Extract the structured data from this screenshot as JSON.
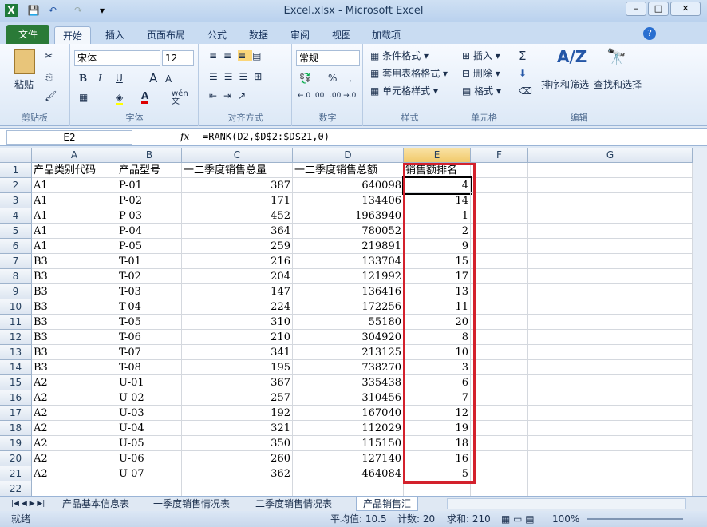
{
  "window": {
    "title": "Excel.xlsx - Microsoft Excel",
    "min": "–",
    "max": "□",
    "close": "✕"
  },
  "quick_access": {
    "excel_icon": "X",
    "save": "💾",
    "undo": "↶",
    "redo": "↷",
    "customize": "▾"
  },
  "tabs": [
    "文件",
    "开始",
    "插入",
    "页面布局",
    "公式",
    "数据",
    "审阅",
    "视图",
    "加载项"
  ],
  "ribbon": {
    "clipboard": {
      "label": "剪贴板",
      "paste": "粘贴"
    },
    "font": {
      "label": "字体",
      "name": "宋体",
      "size": "12",
      "bold": "B",
      "italic": "I",
      "underline": "U",
      "grow": "A",
      "shrink": "A",
      "color": "A",
      "wen": "wén 文"
    },
    "align": {
      "label": "对齐方式"
    },
    "number": {
      "label": "数字",
      "format": "常规",
      "percent": "%",
      "comma": ",",
      "inc": "←.0 .00",
      "dec": ".00 →.0"
    },
    "styles": {
      "label": "样式",
      "items": [
        "条件格式",
        "套用表格格式",
        "单元格样式"
      ]
    },
    "cells": {
      "label": "单元格",
      "items": [
        "插入",
        "删除",
        "格式"
      ]
    },
    "editing": {
      "label": "编辑",
      "sum": "Σ",
      "sort": "排序和筛选",
      "find": "查找和选择"
    }
  },
  "formula_bar": {
    "name_box": "E2",
    "fx": "fx",
    "formula": "=RANK(D2,$D$2:$D$21,0)"
  },
  "columns": [
    "A",
    "B",
    "C",
    "D",
    "E",
    "F",
    "G"
  ],
  "headers": [
    "产品类别代码",
    "产品型号",
    "一二季度销售总量",
    "一二季度销售总额",
    "销售额排名"
  ],
  "rows": [
    [
      "A1",
      "P-01",
      "387",
      "640098",
      "4"
    ],
    [
      "A1",
      "P-02",
      "171",
      "134406",
      "14"
    ],
    [
      "A1",
      "P-03",
      "452",
      "1963940",
      "1"
    ],
    [
      "A1",
      "P-04",
      "364",
      "780052",
      "2"
    ],
    [
      "A1",
      "P-05",
      "259",
      "219891",
      "9"
    ],
    [
      "B3",
      "T-01",
      "216",
      "133704",
      "15"
    ],
    [
      "B3",
      "T-02",
      "204",
      "121992",
      "17"
    ],
    [
      "B3",
      "T-03",
      "147",
      "136416",
      "13"
    ],
    [
      "B3",
      "T-04",
      "224",
      "172256",
      "11"
    ],
    [
      "B3",
      "T-05",
      "310",
      "55180",
      "20"
    ],
    [
      "B3",
      "T-06",
      "210",
      "304920",
      "8"
    ],
    [
      "B3",
      "T-07",
      "341",
      "213125",
      "10"
    ],
    [
      "B3",
      "T-08",
      "195",
      "738270",
      "3"
    ],
    [
      "A2",
      "U-01",
      "367",
      "335438",
      "6"
    ],
    [
      "A2",
      "U-02",
      "257",
      "310456",
      "7"
    ],
    [
      "A2",
      "U-03",
      "192",
      "167040",
      "12"
    ],
    [
      "A2",
      "U-04",
      "321",
      "112029",
      "19"
    ],
    [
      "A2",
      "U-05",
      "350",
      "115150",
      "18"
    ],
    [
      "A2",
      "U-06",
      "260",
      "127140",
      "16"
    ],
    [
      "A2",
      "U-07",
      "362",
      "464084",
      "5"
    ]
  ],
  "sheet_tabs": [
    "产品基本信息表",
    "一季度销售情况表",
    "二季度销售情况表",
    "产品销售汇"
  ],
  "status": {
    "ready": "就绪",
    "average": "平均值: 10.5",
    "count": "计数: 20",
    "sum": "求和: 210",
    "zoom": "100%"
  },
  "colors": {
    "highlight": "#d3212c",
    "file_tab": "#2a7a37"
  }
}
